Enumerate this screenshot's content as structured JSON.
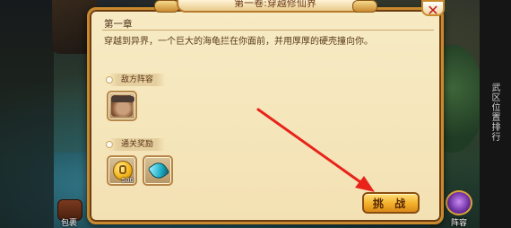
{
  "dialog": {
    "title": "第一卷:穿越修仙界",
    "chapter": "第一章",
    "description": "穿越到异界，一个巨大的海龟拦在你面前，并用厚厚的硬壳撞向你。"
  },
  "enemy_section": {
    "label": "敌方阵容",
    "items": [
      {
        "icon": "warrior-portrait-icon"
      }
    ]
  },
  "reward_section": {
    "label": "通关奖励",
    "items": [
      {
        "icon": "gold-coin-icon",
        "quantity": "500"
      },
      {
        "icon": "jade-gem-icon"
      }
    ]
  },
  "buttons": {
    "challenge": "挑 战",
    "close": "✕"
  },
  "hud": {
    "bottom_left_label": "包裹",
    "bottom_right_label": "阵容",
    "side_text": "武区位置排行"
  },
  "colors": {
    "dialog_bg": "#f3e1b3",
    "border": "#c98a2e",
    "button": "#f3b028",
    "arrow": "#e8231a"
  }
}
